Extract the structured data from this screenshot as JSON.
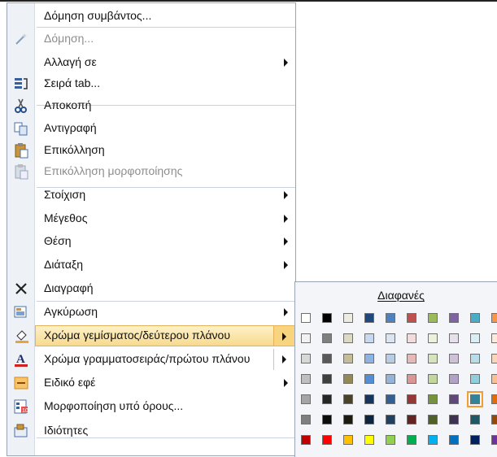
{
  "menu": {
    "items": [
      {
        "label": "Δόμηση συμβάντος...",
        "disabled": false,
        "icon": "",
        "arrow": false
      },
      {
        "label": "Δόμηση...",
        "disabled": true,
        "icon": "build-wand-icon",
        "arrow": false
      },
      {
        "label": "Αλλαγή σε",
        "disabled": false,
        "icon": "",
        "arrow": true
      },
      {
        "label": "Σειρά tab...",
        "disabled": false,
        "icon": "tab-order-icon",
        "arrow": false
      },
      {
        "label": "Αποκοπή",
        "disabled": false,
        "icon": "scissors-icon",
        "arrow": false
      },
      {
        "label": "Αντιγραφή",
        "disabled": false,
        "icon": "copy-icon",
        "arrow": false
      },
      {
        "label": "Επικόλληση",
        "disabled": false,
        "icon": "paste-icon",
        "arrow": false
      },
      {
        "label": "Επικόλληση μορφοποίησης",
        "disabled": true,
        "icon": "paste-format-icon",
        "arrow": false
      },
      {
        "label": "Στοίχιση",
        "disabled": false,
        "icon": "",
        "arrow": true
      },
      {
        "label": "Μέγεθος",
        "disabled": false,
        "icon": "",
        "arrow": true
      },
      {
        "label": "Θέση",
        "disabled": false,
        "icon": "",
        "arrow": true
      },
      {
        "label": "Διάταξη",
        "disabled": false,
        "icon": "",
        "arrow": true
      },
      {
        "label": "Διαγραφή",
        "disabled": false,
        "icon": "delete-x-icon",
        "arrow": false
      },
      {
        "label": "Αγκύρωση",
        "disabled": false,
        "icon": "anchor-icon",
        "arrow": true
      },
      {
        "label": "Χρώμα γεμίσματος/δεύτερου πλάνου",
        "disabled": false,
        "icon": "fill-color-icon",
        "arrow": true,
        "highlight": true
      },
      {
        "label": "Χρώμα γραμματοσειράς/πρώτου πλάνου",
        "disabled": false,
        "icon": "font-color-icon",
        "arrow": true
      },
      {
        "label": "Ειδικό εφέ",
        "disabled": false,
        "icon": "special-effect-icon",
        "arrow": true
      },
      {
        "label": "Μορφοποίηση υπό όρους...",
        "disabled": false,
        "icon": "conditional-format-icon",
        "arrow": false
      },
      {
        "label": "Ιδιότητες",
        "disabled": false,
        "icon": "properties-icon",
        "arrow": false
      }
    ]
  },
  "palette": {
    "title": "Διαφανές",
    "rows": [
      [
        "#ffffff",
        "#000000",
        "#eeece1",
        "#1f497d",
        "#4f81bd",
        "#c0504d",
        "#9bbb59",
        "#8064a2",
        "#4bacc6",
        "#f79646"
      ],
      [
        "#f2f2f2",
        "#7f7f7f",
        "#ddd9c3",
        "#c6d9f0",
        "#dbe5f1",
        "#f2dcdb",
        "#ebf1dd",
        "#e5e0ec",
        "#dbeef3",
        "#fdeada"
      ],
      [
        "#d8d8d8",
        "#595959",
        "#c4bd97",
        "#8db3e2",
        "#b8cce4",
        "#e5b9b7",
        "#d7e3bc",
        "#ccc1d9",
        "#b7dde8",
        "#fbd5b5"
      ],
      [
        "#bfbfbf",
        "#3f3f3f",
        "#938953",
        "#548dd4",
        "#95b3d7",
        "#d99694",
        "#c3d69b",
        "#b2a2c7",
        "#92cddc",
        "#fac08f"
      ],
      [
        "#a5a5a5",
        "#262626",
        "#494429",
        "#17365d",
        "#366092",
        "#953734",
        "#76923c",
        "#5f497a",
        "#31859b",
        "#e36c09"
      ],
      [
        "#7f7f7f",
        "#0c0c0c",
        "#1d1b10",
        "#0f243e",
        "#244061",
        "#632423",
        "#4f6128",
        "#3f3151",
        "#205867",
        "#974806"
      ],
      [
        "#c00000",
        "#ff0000",
        "#ffc000",
        "#ffff00",
        "#92d050",
        "#00b050",
        "#00b0f0",
        "#0070c0",
        "#002060",
        "#7030a0"
      ]
    ],
    "selected": "#4bacc6"
  }
}
